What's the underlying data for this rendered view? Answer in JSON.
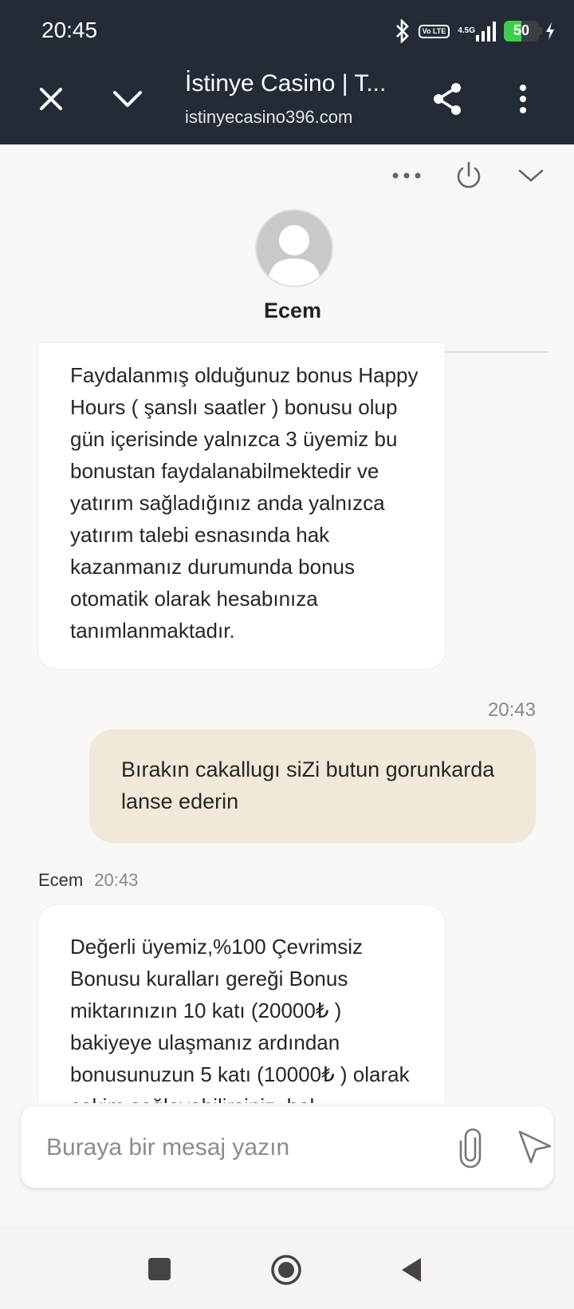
{
  "status_bar": {
    "time": "20:45",
    "battery": "50",
    "battery_level": 0.5,
    "network": "4.5G",
    "volte": "Vo LTE"
  },
  "browser": {
    "title": "İstinye Casino | T...",
    "url": "istinyecasino396.com"
  },
  "chat": {
    "agent_name": "Ecem",
    "messages": [
      {
        "sender": "Ecem",
        "text": "Faydalanmış olduğunuz bonus Happy Hours ( şanslı saatler ) bonusu olup gün içerisinde yalnızca 3 üyemiz bu bonustan faydalanabilmektedir ve yatırım sağladığınız anda yalnızca yatırım talebi esnasında hak kazanmanız durumunda bonus otomatik olarak hesabınıza tanımlanmaktadır."
      },
      {
        "sender": "user",
        "time": "20:43",
        "text": "Bırakın cakallugı siZi butun gorunkarda lanse ederin"
      },
      {
        "sender": "Ecem",
        "time": "20:43",
        "text": "Değerli üyemiz,%100 Çevrimsiz Bonusu kuralları gereği Bonus miktarınızın 10 katı (20000₺ ) bakiyeye ulaşmanız ardından bonusunuzun 5 katı (10000₺ ) olarak çekim sağlayabilirsiniz. hal"
      }
    ]
  },
  "composer": {
    "placeholder": "Buraya bir mesaj yazın"
  },
  "colors": {
    "topbar": "#232b36",
    "user_bubble": "#f0e8d8",
    "background": "#f8f7f5"
  },
  "icons": [
    "bluetooth-icon",
    "signal-icon",
    "battery-icon",
    "close-icon",
    "chevron-down-icon",
    "share-icon",
    "more-vertical-icon",
    "more-horizontal-icon",
    "power-icon",
    "paperclip-icon",
    "send-icon",
    "recent-apps-icon",
    "home-icon",
    "back-icon"
  ]
}
